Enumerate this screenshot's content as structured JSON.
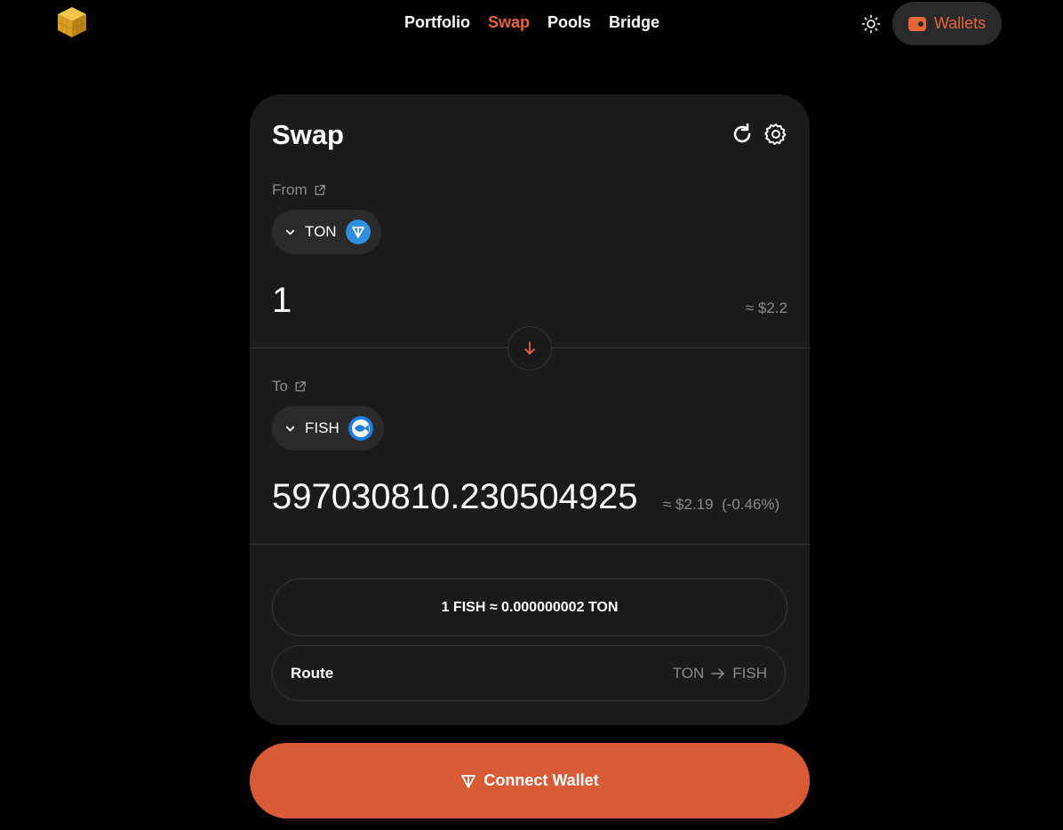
{
  "header": {
    "logo_icon": "gold-cube-icon",
    "nav": [
      {
        "label": "Portfolio",
        "active": false
      },
      {
        "label": "Swap",
        "active": true
      },
      {
        "label": "Pools",
        "active": false
      },
      {
        "label": "Bridge",
        "active": false
      }
    ],
    "theme_icon": "sun-icon",
    "wallets_label": "Wallets"
  },
  "swap": {
    "title": "Swap",
    "from": {
      "label": "From",
      "token": "TON",
      "amount": "1",
      "usd": "≈ $2.2"
    },
    "to": {
      "label": "To",
      "token": "FISH",
      "amount": "597030810.230504925",
      "usd": "≈ $2.19",
      "impact": "(-0.46%)"
    },
    "rate": "1 FISH ≈ 0.000000002 TON",
    "route": {
      "label": "Route",
      "from": "TON",
      "to": "FISH"
    }
  },
  "connect_label": "Connect Wallet",
  "colors": {
    "accent": "#e8643a",
    "button": "#d95b35",
    "card": "#1b1b1b",
    "ton_blue": "#2f8fe0"
  }
}
